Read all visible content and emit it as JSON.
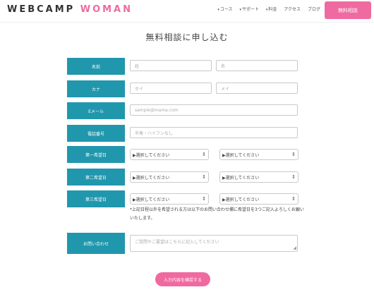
{
  "header": {
    "logo_part1": "WEBCAMP",
    "logo_part2": "WOMAN",
    "nav": [
      {
        "label": "コース",
        "dropdown": true
      },
      {
        "label": "サポート",
        "dropdown": true
      },
      {
        "label": "料金",
        "dropdown": true
      },
      {
        "label": "アクセス",
        "dropdown": false
      },
      {
        "label": "ブログ",
        "dropdown": false
      }
    ],
    "cta_label": "無料相談"
  },
  "form": {
    "title": "無料相談に申し込む",
    "name_label": "名前",
    "last_name_placeholder": "姓",
    "first_name_placeholder": "名",
    "kana_label": "カナ",
    "last_kana_placeholder": "セイ",
    "first_kana_placeholder": "メイ",
    "email_label": "Eメール",
    "email_placeholder": "sample@mama.com",
    "phone_label": "電話番号",
    "phone_placeholder": "半角・ハイフンなし",
    "choice1_label": "第一希望日",
    "choice2_label": "第二希望日",
    "choice3_label": "第三希望日",
    "select_placeholder": "▶選択してください",
    "note": "*上記日程以外を希望される方は以下のお問い合わせ欄に希望日を3つご記入よろしくお願いいたします。",
    "inquiry_label": "お問い合わせ",
    "inquiry_placeholder": "ご質問やご要望はこちらに記入してください",
    "submit_label": "入力内容を確認する"
  },
  "colors": {
    "accent_pink": "#ef6aa0",
    "label_teal": "#2097ad"
  }
}
